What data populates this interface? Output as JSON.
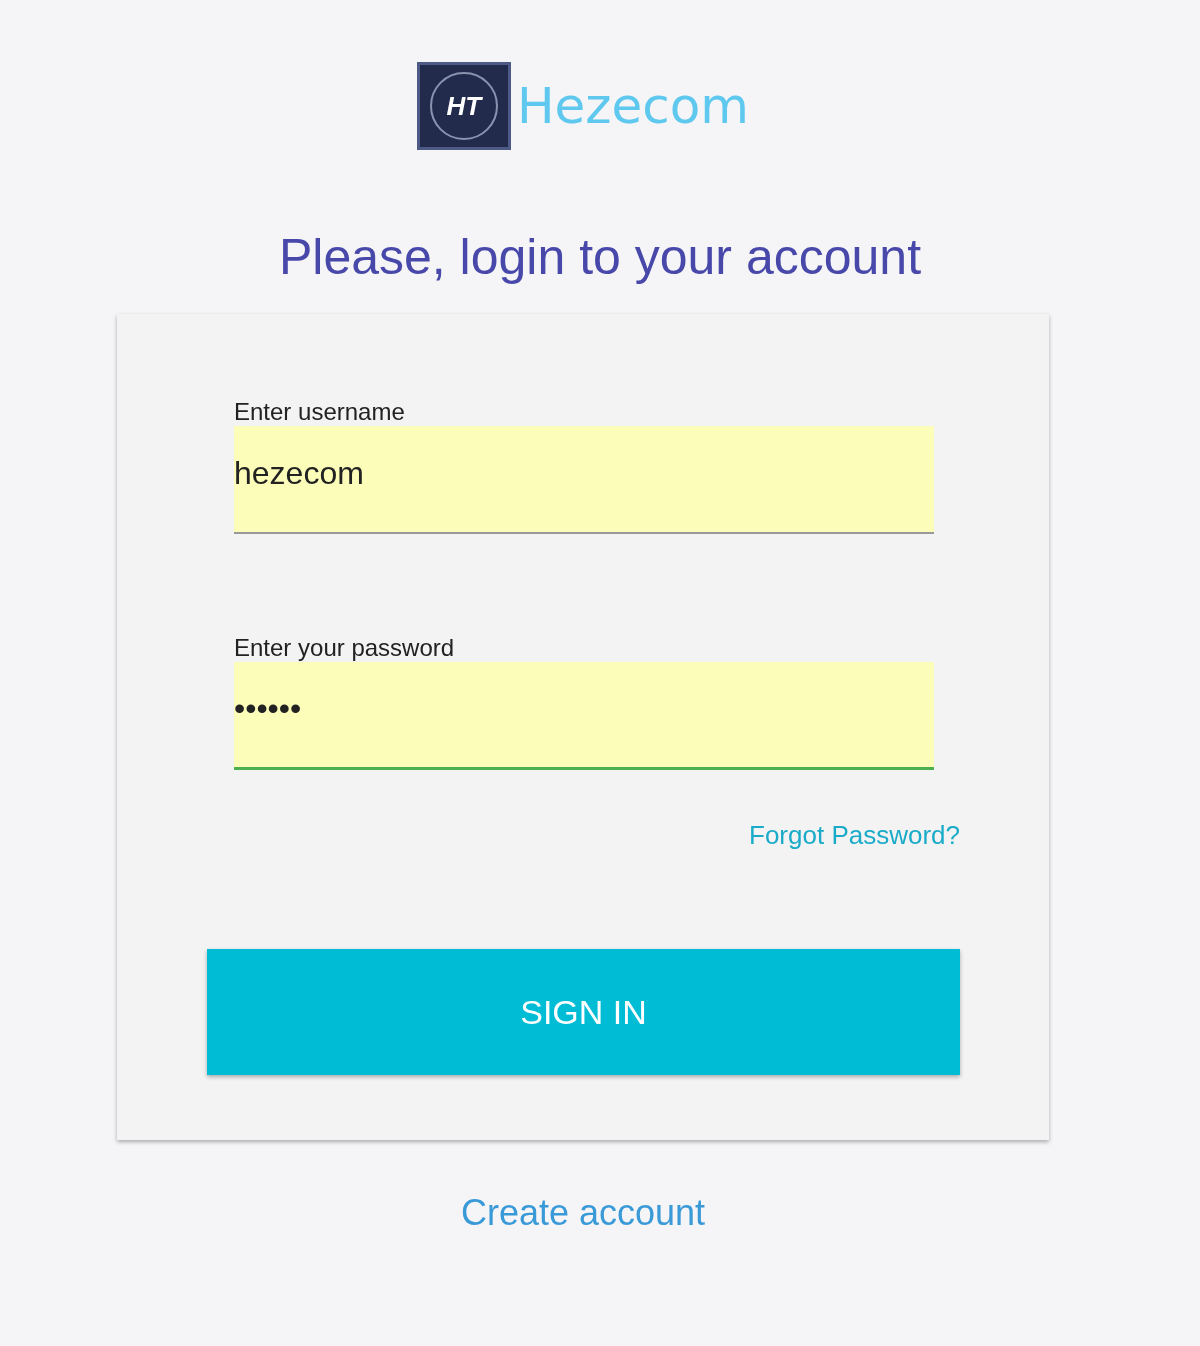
{
  "logo": {
    "mark": "HT",
    "name": "Hezecom"
  },
  "heading": "Please, login to your account",
  "fields": [
    {
      "label": "Enter username",
      "value": "hezecom",
      "focused": false
    },
    {
      "label": "Enter your password",
      "value": "••••••",
      "focused": true
    }
  ],
  "forgot_link": "Forgot Password?",
  "sign_in_button": "SIGN IN",
  "create_account_link": "Create account"
}
